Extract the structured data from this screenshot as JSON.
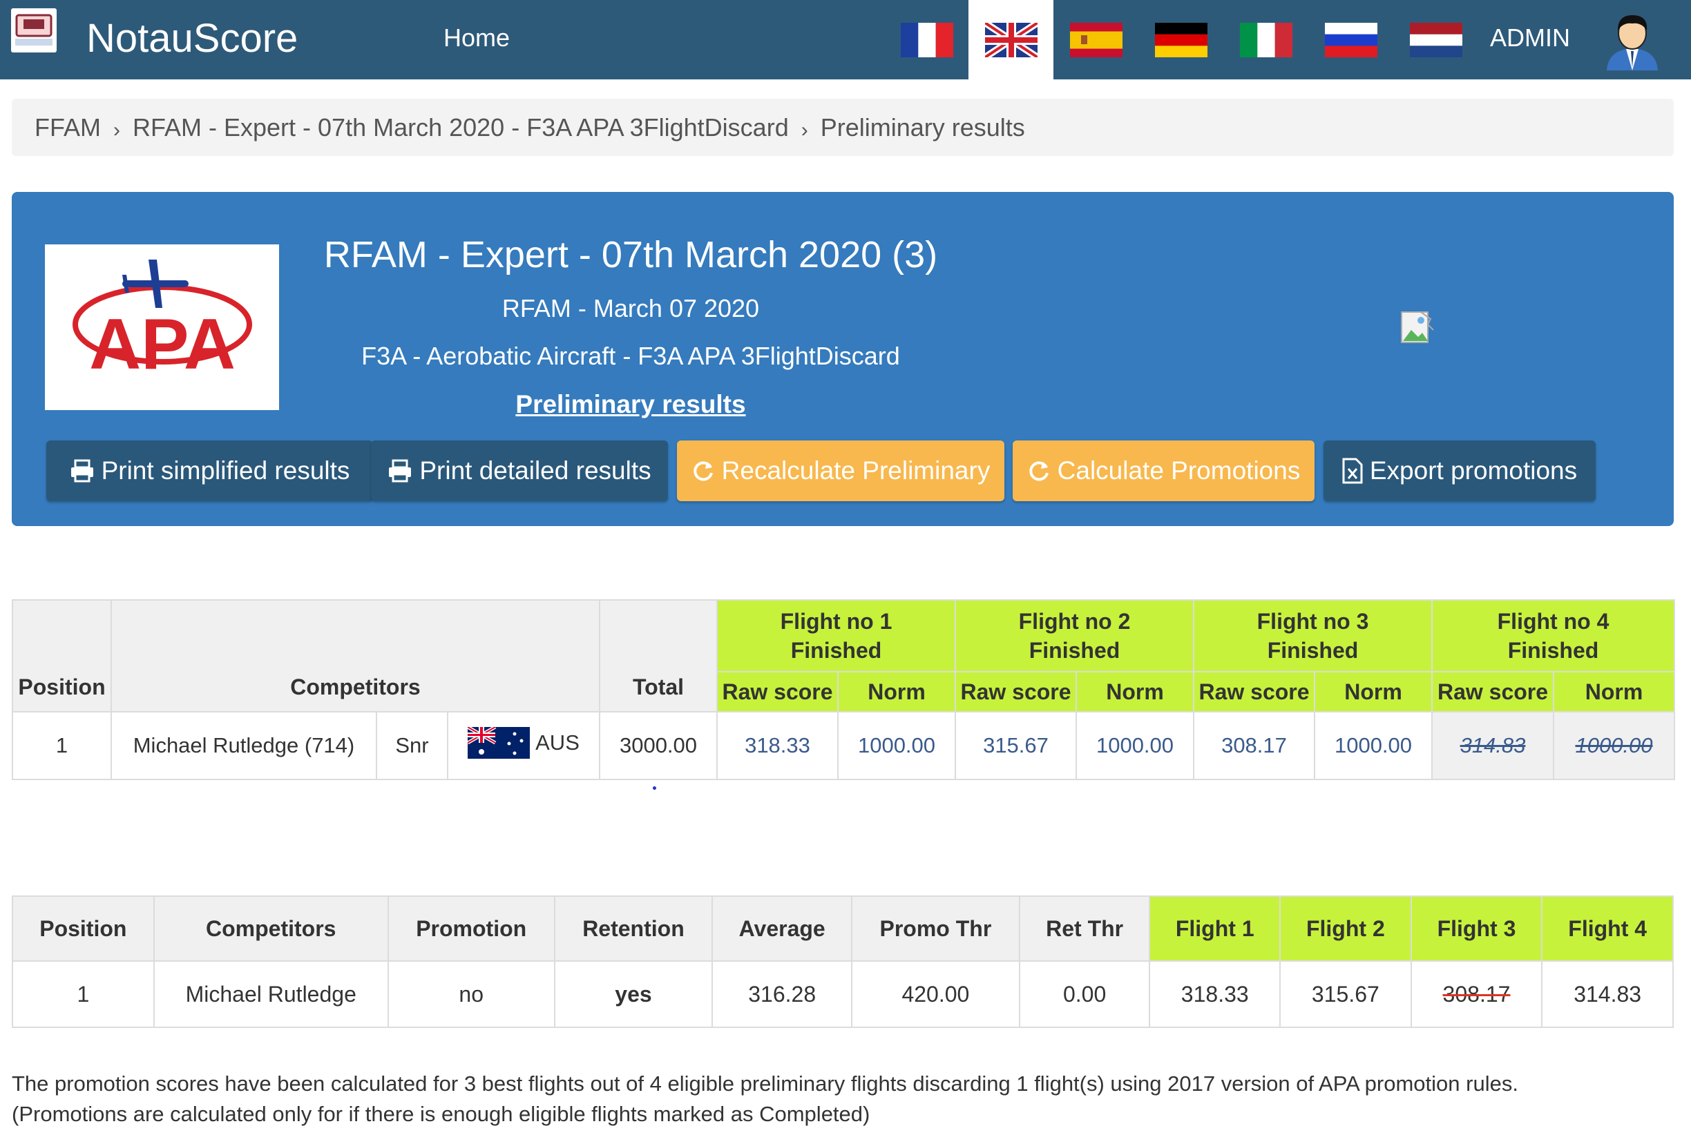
{
  "navbar": {
    "brand": "NotauScore",
    "home": "Home",
    "admin": "ADMIN",
    "flags": [
      "fr-flag",
      "uk-flag",
      "es-flag",
      "de-flag",
      "it-flag",
      "ru-flag",
      "nl-flag"
    ],
    "active_flag": "uk-flag"
  },
  "breadcrumb": {
    "items": [
      "FFAM",
      "RFAM - Expert - 07th March 2020 - F3A APA 3FlightDiscard",
      "Preliminary results"
    ]
  },
  "panel": {
    "title": "RFAM - Expert - 07th March 2020 (3)",
    "subtitle": "RFAM - March 07 2020",
    "category": "F3A - Aerobatic Aircraft - F3A APA 3FlightDiscard",
    "results_link": "Preliminary results",
    "logo_text": "APA",
    "buttons": {
      "print_simplified": "Print simplified results",
      "print_detailed": "Print detailed results",
      "recalculate": "Recalculate Preliminary",
      "calculate_promotions": "Calculate Promotions",
      "export_promotions": "Export promotions"
    }
  },
  "results": {
    "headers": {
      "position": "Position",
      "competitors": "Competitors",
      "total": "Total",
      "flights": [
        {
          "title": "Flight no 1",
          "status": "Finished"
        },
        {
          "title": "Flight no 2",
          "status": "Finished"
        },
        {
          "title": "Flight no 3",
          "status": "Finished"
        },
        {
          "title": "Flight no 4",
          "status": "Finished"
        }
      ],
      "raw": "Raw score",
      "norm": "Norm"
    },
    "row": {
      "position": "1",
      "name": "Michael Rutledge (714)",
      "class": "Snr",
      "country": "AUS",
      "total": "3000.00",
      "scores": [
        {
          "raw": "318.33",
          "norm": "1000.00"
        },
        {
          "raw": "315.67",
          "norm": "1000.00"
        },
        {
          "raw": "308.17",
          "norm": "1000.00"
        },
        {
          "raw": "314.83",
          "norm": "1000.00"
        }
      ]
    }
  },
  "promotions": {
    "headers": {
      "position": "Position",
      "competitors": "Competitors",
      "promotion": "Promotion",
      "retention": "Retention",
      "average": "Average",
      "promo_thr": "Promo Thr",
      "ret_thr": "Ret Thr",
      "flight1": "Flight 1",
      "flight2": "Flight 2",
      "flight3": "Flight 3",
      "flight4": "Flight 4"
    },
    "row": {
      "position": "1",
      "name": "Michael Rutledge",
      "promotion": "no",
      "retention": "yes",
      "average": "316.28",
      "promo_thr": "420.00",
      "ret_thr": "0.00",
      "flight1": "318.33",
      "flight2": "315.67",
      "flight3": "308.17",
      "flight4": "314.83"
    }
  },
  "footnote": {
    "line1": "The promotion scores have been calculated for 3 best flights out of 4 eligible preliminary flights discarding 1 flight(s) using 2017 version of APA promotion rules.",
    "line2": "(Promotions are calculated only for if there is enough eligible flights marked as Completed)"
  },
  "colors": {
    "navbar": "#2e5a7a",
    "panel": "#357bbd",
    "dark_button": "#2a587a",
    "orange_button": "#f8b84e",
    "flight_header": "#c7f23b"
  }
}
